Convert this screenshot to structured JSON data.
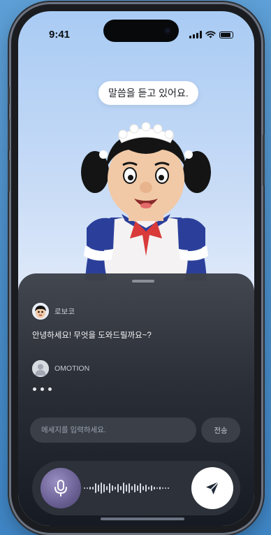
{
  "status_bar": {
    "time": "9:41"
  },
  "assistant": {
    "speech_bubble": "말씀을 듣고 있어요."
  },
  "chat": {
    "messages": [
      {
        "sender": "로보코",
        "text": "안녕하세요! 무엇을 도와드릴까요~?"
      },
      {
        "sender": "OMOTION",
        "typing": true
      }
    ]
  },
  "composer": {
    "placeholder": "메세지를 입력하세요.",
    "send_label": "전송"
  },
  "voice": {
    "mic_icon": "microphone-icon",
    "send_icon": "paper-plane-icon"
  },
  "colors": {
    "background": "#4a8fcc",
    "sheet": "#262a32",
    "mic_accent": "#6d6396"
  }
}
